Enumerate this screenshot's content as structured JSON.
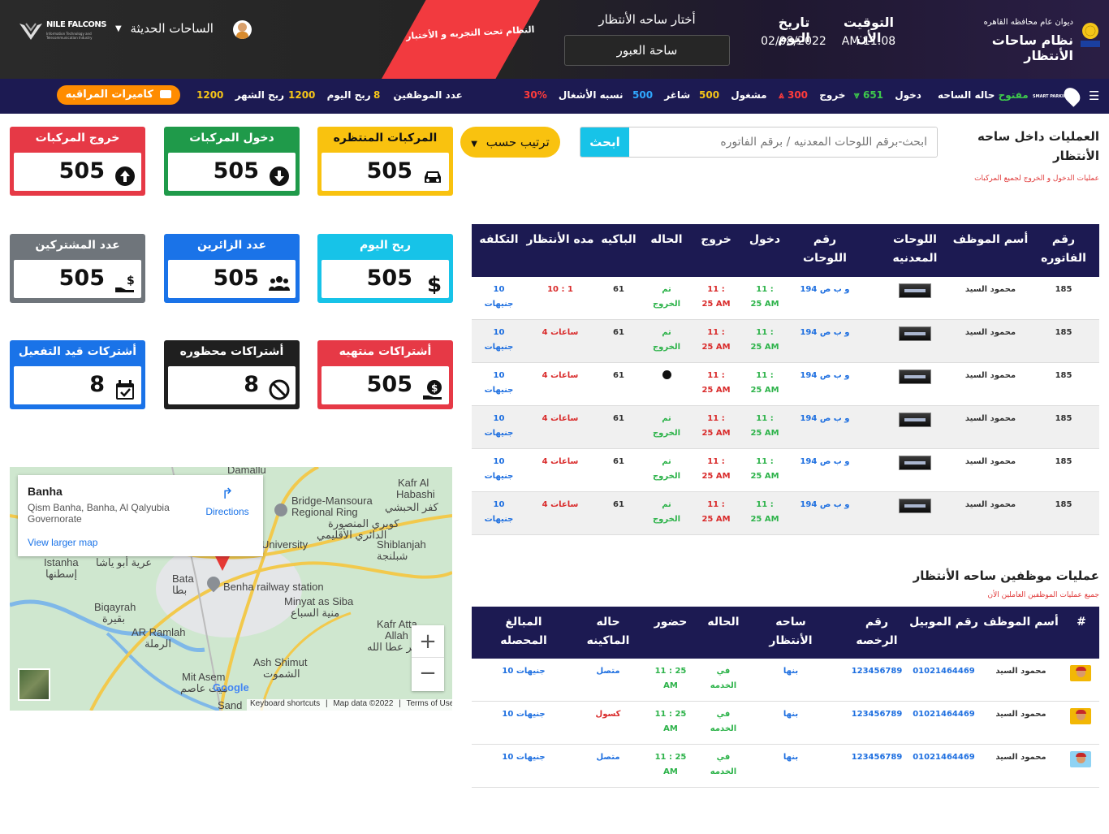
{
  "header": {
    "org_name": "ديوان عام محافظه القاهره",
    "system_name": "نظام ساحات الأنتظار",
    "time_label": "التوقيت الأن",
    "time_value": "AM 11:08",
    "date_label": "تاريخ اليوم",
    "date_value": "02/08/2022",
    "select_label": "أختار ساحه الأنتظار",
    "select_value": "ساحة العبور",
    "trial_banner": "النظام تحت التجربه و الأختبار",
    "yards_menu": "الساحات الحديثة",
    "logo_brand": "NILE FALCONS",
    "logo_sub": "Information Technology and Telecommunication Industry",
    "smart_parking": "SMART PARKING"
  },
  "navbar": {
    "yard_state_label": "حاله الساحه",
    "yard_state_value": "مفتوح",
    "entry_label": "دخول",
    "entry_value": "651",
    "exit_label": "خروج",
    "exit_value": "300",
    "occupied_label": "مشغول",
    "occupied_value": "500",
    "vacant_label": "شاغر",
    "vacant_value": "500",
    "occupancy_label": "نسبه الأشغال",
    "occupancy_value": "30%",
    "employees_label": "عدد الموظفين",
    "employees_value": "8",
    "day_profit_label": "ربح اليوم",
    "day_profit_value": "1200",
    "month_profit_label": "ربح الشهر",
    "month_profit_value": "1200",
    "cameras_button": "كاميرات المراقبه"
  },
  "operations": {
    "title": "العمليات داخل ساحه الأنتظار",
    "subtitle": "عمليات الدخول و الخروج لجميع المركبات",
    "search_placeholder": "ابحث-برقم اللوحات المعدنيه / برقم الفاتوره",
    "search_button": "ابحث",
    "sort_button": "ترتيب حسب",
    "columns": [
      "رقم الفاتوره",
      "أسم الموظف",
      "اللوحات المعدنيه",
      "رقم اللوحات",
      "دخول",
      "خروج",
      "الحاله",
      "الباكيه",
      "مده الأنتظار",
      "التكلفه"
    ],
    "rows": [
      {
        "invoice": "185",
        "employee": "محمود السيد",
        "plate_no": "و ب ص 194",
        "entry": "11 : 25 AM",
        "exit": "11 : 25 AM",
        "status": "تم الخروج",
        "bay": "61",
        "duration": "10 : 1",
        "cost": "10 جنيهات"
      },
      {
        "invoice": "185",
        "employee": "محمود السيد",
        "plate_no": "و ب ص 194",
        "entry": "11 : 25 AM",
        "exit": "11 : 25 AM",
        "status": "تم الخروج",
        "bay": "61",
        "duration": "4 ساعات",
        "cost": "10 جنيهات"
      },
      {
        "invoice": "185",
        "employee": "محمود السيد",
        "plate_no": "و ب ص 194",
        "entry": "11 : 25 AM",
        "exit": "11 : 25 AM",
        "status": "",
        "bay": "61",
        "duration": "4 ساعات",
        "cost": "10 جنيهات"
      },
      {
        "invoice": "185",
        "employee": "محمود السيد",
        "plate_no": "و ب ص 194",
        "entry": "11 : 25 AM",
        "exit": "11 : 25 AM",
        "status": "تم الخروج",
        "bay": "61",
        "duration": "4 ساعات",
        "cost": "10 جنيهات"
      },
      {
        "invoice": "185",
        "employee": "محمود السيد",
        "plate_no": "و ب ص 194",
        "entry": "11 : 25 AM",
        "exit": "11 : 25 AM",
        "status": "تم الخروج",
        "bay": "61",
        "duration": "4 ساعات",
        "cost": "10 جنيهات"
      },
      {
        "invoice": "185",
        "employee": "محمود السيد",
        "plate_no": "و ب ص 194",
        "entry": "11 : 25 AM",
        "exit": "11 : 25 AM",
        "status": "تم الخروج",
        "bay": "61",
        "duration": "4 ساعات",
        "cost": "10 جنيهات"
      }
    ]
  },
  "cards": {
    "exit_vehicles": {
      "label": "خروج المركبات",
      "value": "505"
    },
    "entry_vehicles": {
      "label": "دخول المركبات",
      "value": "505"
    },
    "waiting_vehicles": {
      "label": "المركبات المنتظره",
      "value": "505"
    },
    "subscribers": {
      "label": "عدد المشتركين",
      "value": "505"
    },
    "visitors": {
      "label": "عدد الزائرين",
      "value": "505"
    },
    "day_profit": {
      "label": "ربح اليوم",
      "value": "505"
    },
    "pending_subs": {
      "label": "أشتركات قيد التفعيل",
      "value": "8"
    },
    "banned_subs": {
      "label": "أشتراكات محظوره",
      "value": "8"
    },
    "expired_subs": {
      "label": "أشتراكات منتهيه",
      "value": "505"
    }
  },
  "map": {
    "place_name": "Banha",
    "place_address": "Qism Banha, Banha, Al Qalyubia Governorate",
    "directions": "Directions",
    "larger_map": "View larger map",
    "footer_shortcuts": "Keyboard shortcuts",
    "footer_data": "Map data ©2022",
    "footer_terms": "Terms of Use",
    "labels": [
      "Damallu",
      "Kafr Al",
      "Habashi",
      "كفر الحبشي",
      "Bridge-Mansoura",
      "Regional Ring",
      "كوبري المنصورة",
      "الدائري الأقليمي",
      "University",
      "Shiblanjah",
      "شبلنجة",
      "Istanha",
      "إسطنها",
      "عرية أبو ياشا",
      "Bata",
      "بطا",
      "Benha railway station",
      "Minyat as Siba",
      "منية السباع",
      "Biqayrah",
      "بقيرة",
      "AR Ramlah",
      "الرملة",
      "Kafr Atta",
      "Allah",
      "كفر عطا الله",
      "Ash Shimut",
      "الشموت",
      "Mit Asem",
      "ميت عاصم",
      "Sand",
      "Google"
    ]
  },
  "staff": {
    "title": "عمليات موظفين ساحه الأنتظار",
    "subtitle": "جميع عمليات الموظفين العاملين الأن",
    "columns": [
      "#",
      "أسم الموظف",
      "رقم الموبيل",
      "رقم الرخصه",
      "ساحه الأنتظار",
      "الحاله",
      "حضور",
      "حاله الماكينه",
      "المبالغ المحصله"
    ],
    "rows": [
      {
        "name": "محمود السيد",
        "mobile": "01021464469",
        "license": "123456789",
        "yard": "بنها",
        "status": "في الخدمه",
        "attendance": "11 : 25 AM",
        "machine": "متصل",
        "amount": "10 جنيهات"
      },
      {
        "name": "محمود السيد",
        "mobile": "01021464469",
        "license": "123456789",
        "yard": "بنها",
        "status": "في الخدمه",
        "attendance": "11 : 25 AM",
        "machine": "كسول",
        "amount": "10 جنيهات"
      },
      {
        "name": "محمود السيد",
        "mobile": "01021464469",
        "license": "123456789",
        "yard": "بنها",
        "status": "في الخدمه",
        "attendance": "11 : 25 AM",
        "machine": "متصل",
        "amount": "10 جنيهات"
      }
    ]
  },
  "colors": {
    "navy": "#1c1a52",
    "red": "#e63946",
    "green": "#1f9a4a",
    "yellow": "#f9c20f",
    "gray": "#6f757b",
    "blue": "#1a73e8",
    "cyan": "#17c3e8",
    "black": "#1f1f1f"
  }
}
